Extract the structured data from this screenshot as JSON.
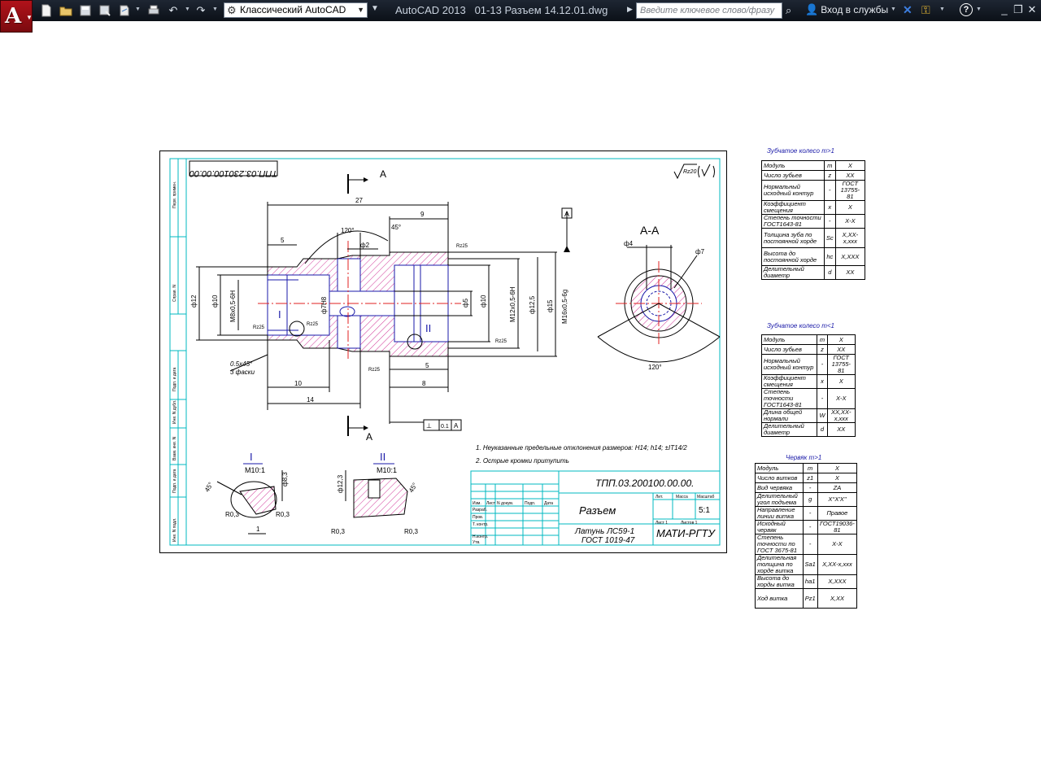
{
  "titlebar": {
    "workspace": "Классический AutoCAD",
    "app_name": "AutoCAD 2013",
    "file_name": "01-13 Разъем 14.12.01.dwg",
    "search_placeholder": "Введите ключевое слово/фразу",
    "sign_in": "Вход в службы"
  },
  "drawing": {
    "designation": "ТПП.03.200100.00.00.",
    "designation_mirrored": "ТПП.03.230100.00.00",
    "part_name": "Разъем",
    "material_line1": "Латунь ЛС59-1",
    "material_line2": "ГОСТ 1019-47",
    "organization": "МАТИ-РГТУ",
    "scale": "5:1",
    "sheet": "Лист 1",
    "roughness": "Rz20",
    "section_mark": "А",
    "section_title": "А-А",
    "datum": "А",
    "tolerance_value": "0.1",
    "notes": [
      "1. Неуказанные предельные отклонения размеров: H14; h14; ±IT14/2",
      "2. Острые кромки притупить"
    ],
    "chamfer_note_1": "0.5x45°",
    "chamfer_note_2": "3 фаски",
    "detail_1": {
      "label": "I",
      "scale": "M10:1"
    },
    "detail_2": {
      "label": "II",
      "scale": "M10:1"
    },
    "dims": {
      "d27": "27",
      "d9": "9",
      "d5": "5",
      "a120": "120°",
      "a45": "45°",
      "d2": "ф2",
      "d12": "ф12",
      "d10": "ф10",
      "m8": "M8x0,5-6H",
      "d7": "ф7H8",
      "d5b": "ф5",
      "d10b": "ф10",
      "m12": "M12x0,5-6H",
      "d12_5": "ф12,5",
      "d15": "ф15",
      "m16": "M16x0,5-6g",
      "d10l": "10",
      "d14": "14",
      "d8": "8",
      "d5c": "5",
      "r025": "Rz25",
      "r025b": "Rz25",
      "r025c": "Rz25",
      "r025d": "Rz25",
      "sec_d4": "ф4",
      "sec_d7": "ф7",
      "sec_a120": "120°",
      "det1_a45": "45°",
      "det1_d8": "ф8,3",
      "det1_r1": "R0,3",
      "det1_r2": "R0,3",
      "det1_1": "1",
      "det2_d12": "ф12,3",
      "det2_a45": "45°",
      "det2_r1": "R0,3",
      "det2_r2": "R0,3"
    },
    "stamp_headers": [
      "Изм.",
      "Лист",
      "N докум.",
      "Подп.",
      "Дата"
    ],
    "stamp_roles": [
      "Разраб.",
      "Пров.",
      "Т. контр.",
      "",
      "Н.контр.",
      "Утв."
    ],
    "stamp_cols": [
      "Лит.",
      "Масса",
      "Масштаб"
    ],
    "stamp_sheets": "Листов 1",
    "side_strip": [
      "Перв. примен.",
      "Справ. N",
      "Подп. и дата",
      "Инв. N дубл.",
      "Взам. инв. N",
      "Подп. и дата",
      "Инв. N подл."
    ]
  },
  "table1": {
    "title": "Зубчатое колесо m>1",
    "rows": [
      [
        "Модуль",
        "m",
        "X"
      ],
      [
        "Число зубьев",
        "z",
        "XX"
      ],
      [
        "Нормальный исходный контур",
        "-",
        "ГОСТ 13755-81"
      ],
      [
        "Коэффициент смещения",
        "x",
        "X"
      ],
      [
        "Степень точности ГОСТ1643-81",
        "-",
        "X-X"
      ],
      [
        "Толщина зуба по постоянной хорде",
        "Sc",
        "X,XX-x,xxx"
      ],
      [
        "Высота до постоянной хорде",
        "hc",
        "X,XXX"
      ],
      [
        "Делительный диаметр",
        "d",
        "XX"
      ]
    ]
  },
  "table2": {
    "title": "Зубчатое колесо m<1",
    "rows": [
      [
        "Модуль",
        "m",
        "X"
      ],
      [
        "Число зубьев",
        "z",
        "XX"
      ],
      [
        "Нормальный исходный контур",
        "-",
        "ГОСТ 13755-81"
      ],
      [
        "Коэффициент смещения",
        "x",
        "X"
      ],
      [
        "Степень точности ГОСТ1643-81",
        "-",
        "X-X"
      ],
      [
        "Длина общей нормали",
        "W",
        "XX,XX-x,xxx"
      ],
      [
        "Делительный диаметр",
        "d",
        "XX"
      ]
    ]
  },
  "table3": {
    "title": "Червяк m>1",
    "rows": [
      [
        "Модуль",
        "m",
        "X"
      ],
      [
        "Число витков",
        "z1",
        "X"
      ],
      [
        "Вид червяка",
        "-",
        "ZA"
      ],
      [
        "Делительный угол подъема",
        "g",
        "X°X'X\""
      ],
      [
        "Направление линии витка",
        "-",
        "Правое"
      ],
      [
        "Исходный червяк",
        "-",
        "ГОСТ19036-81"
      ],
      [
        "Степень точности по ГОСТ 3675-81",
        "-",
        "X-X"
      ],
      [
        "Делительная толщина по хорде витка",
        "Sa1",
        "X,XX-x,xxx"
      ],
      [
        "Высота до хорды витка",
        "ha1",
        "X,XXX"
      ],
      [
        "Ход витка",
        "Pz1",
        "X,XX"
      ]
    ]
  }
}
